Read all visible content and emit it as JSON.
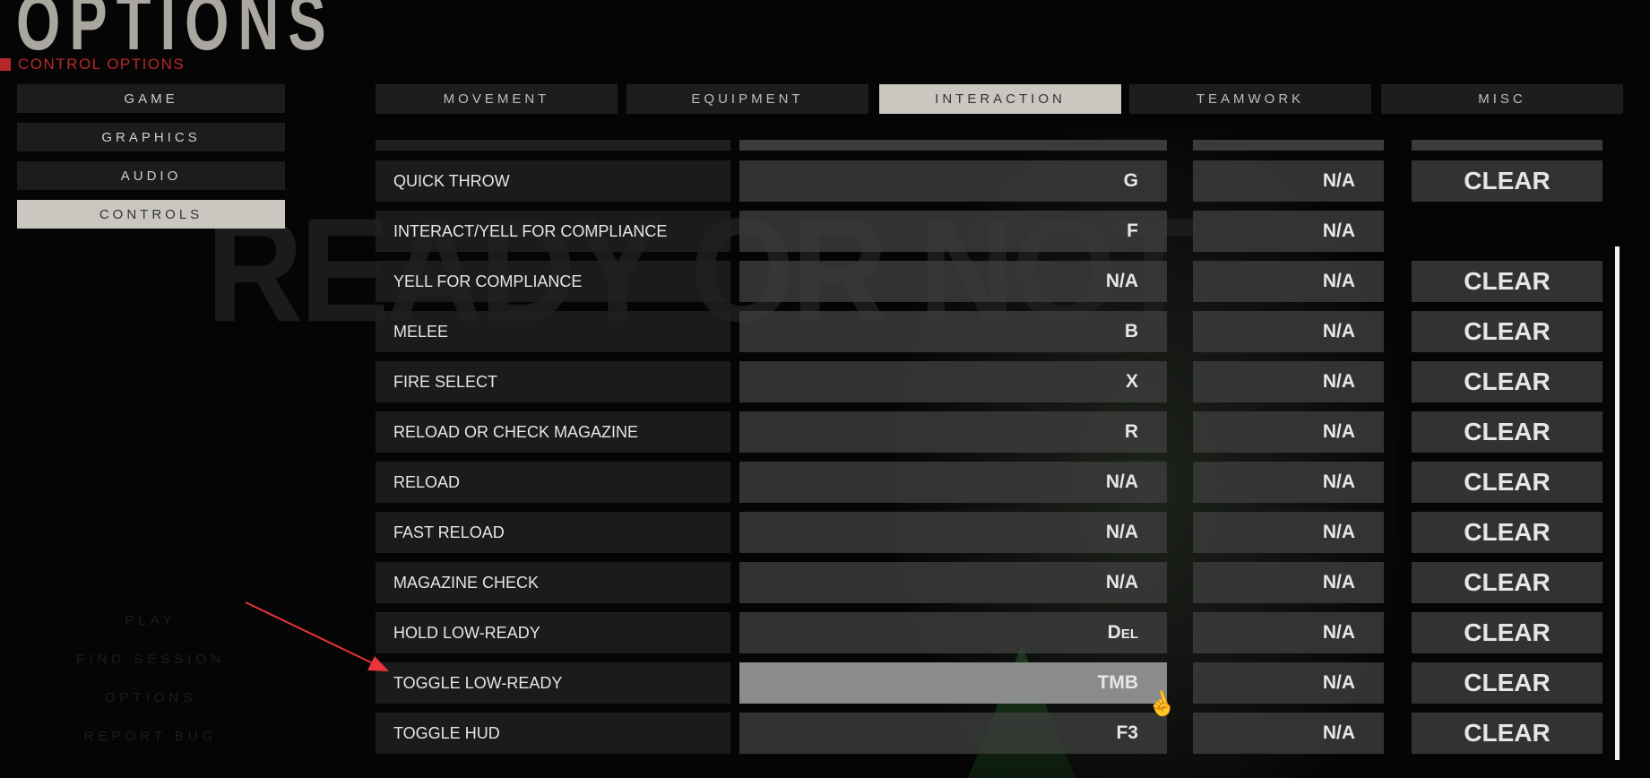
{
  "title": "OPTIONS",
  "subtitle": "CONTROL OPTIONS",
  "background_logo": "READY OR NOT",
  "side_menu": [
    {
      "label": "GAME"
    },
    {
      "label": "GRAPHICS"
    },
    {
      "label": "AUDIO"
    },
    {
      "label": "CONTROLS",
      "active": true
    }
  ],
  "tabs": [
    {
      "label": "MOVEMENT"
    },
    {
      "label": "EQUIPMENT"
    },
    {
      "label": "INTERACTION",
      "active": true
    },
    {
      "label": "TEAMWORK"
    },
    {
      "label": "MISC"
    }
  ],
  "bindings": [
    {
      "action": "QUICK THROW",
      "primary": "G",
      "secondary": "N/A",
      "clear": "CLEAR"
    },
    {
      "action": "INTERACT/YELL FOR COMPLIANCE",
      "primary": "F",
      "secondary": "N/A",
      "clear": ""
    },
    {
      "action": "YELL FOR COMPLIANCE",
      "primary": "N/A",
      "secondary": "N/A",
      "clear": "CLEAR"
    },
    {
      "action": "MELEE",
      "primary": "B",
      "secondary": "N/A",
      "clear": "CLEAR"
    },
    {
      "action": "FIRE SELECT",
      "primary": "X",
      "secondary": "N/A",
      "clear": "CLEAR"
    },
    {
      "action": "RELOAD OR CHECK MAGAZINE",
      "primary": "R",
      "secondary": "N/A",
      "clear": "CLEAR"
    },
    {
      "action": "RELOAD",
      "primary": "N/A",
      "secondary": "N/A",
      "clear": "CLEAR"
    },
    {
      "action": "FAST RELOAD",
      "primary": "N/A",
      "secondary": "N/A",
      "clear": "CLEAR"
    },
    {
      "action": "MAGAZINE CHECK",
      "primary": "N/A",
      "secondary": "N/A",
      "clear": "CLEAR"
    },
    {
      "action": "HOLD LOW-READY",
      "primary": "Del",
      "secondary": "N/A",
      "clear": "CLEAR"
    },
    {
      "action": "TOGGLE LOW-READY",
      "primary": "TMB",
      "secondary": "N/A",
      "clear": "CLEAR",
      "highlighted": true
    },
    {
      "action": "TOGGLE HUD",
      "primary": "F3",
      "secondary": "N/A",
      "clear": "CLEAR"
    }
  ],
  "faded_menu": [
    {
      "label": "PLAY"
    },
    {
      "label": "FIND SESSION"
    },
    {
      "label": "OPTIONS"
    },
    {
      "label": "REPORT BUG"
    }
  ],
  "colors": {
    "accent_red": "#b8282b",
    "active_tab": "#c9c7c0",
    "annotation_arrow": "#e8343a"
  }
}
